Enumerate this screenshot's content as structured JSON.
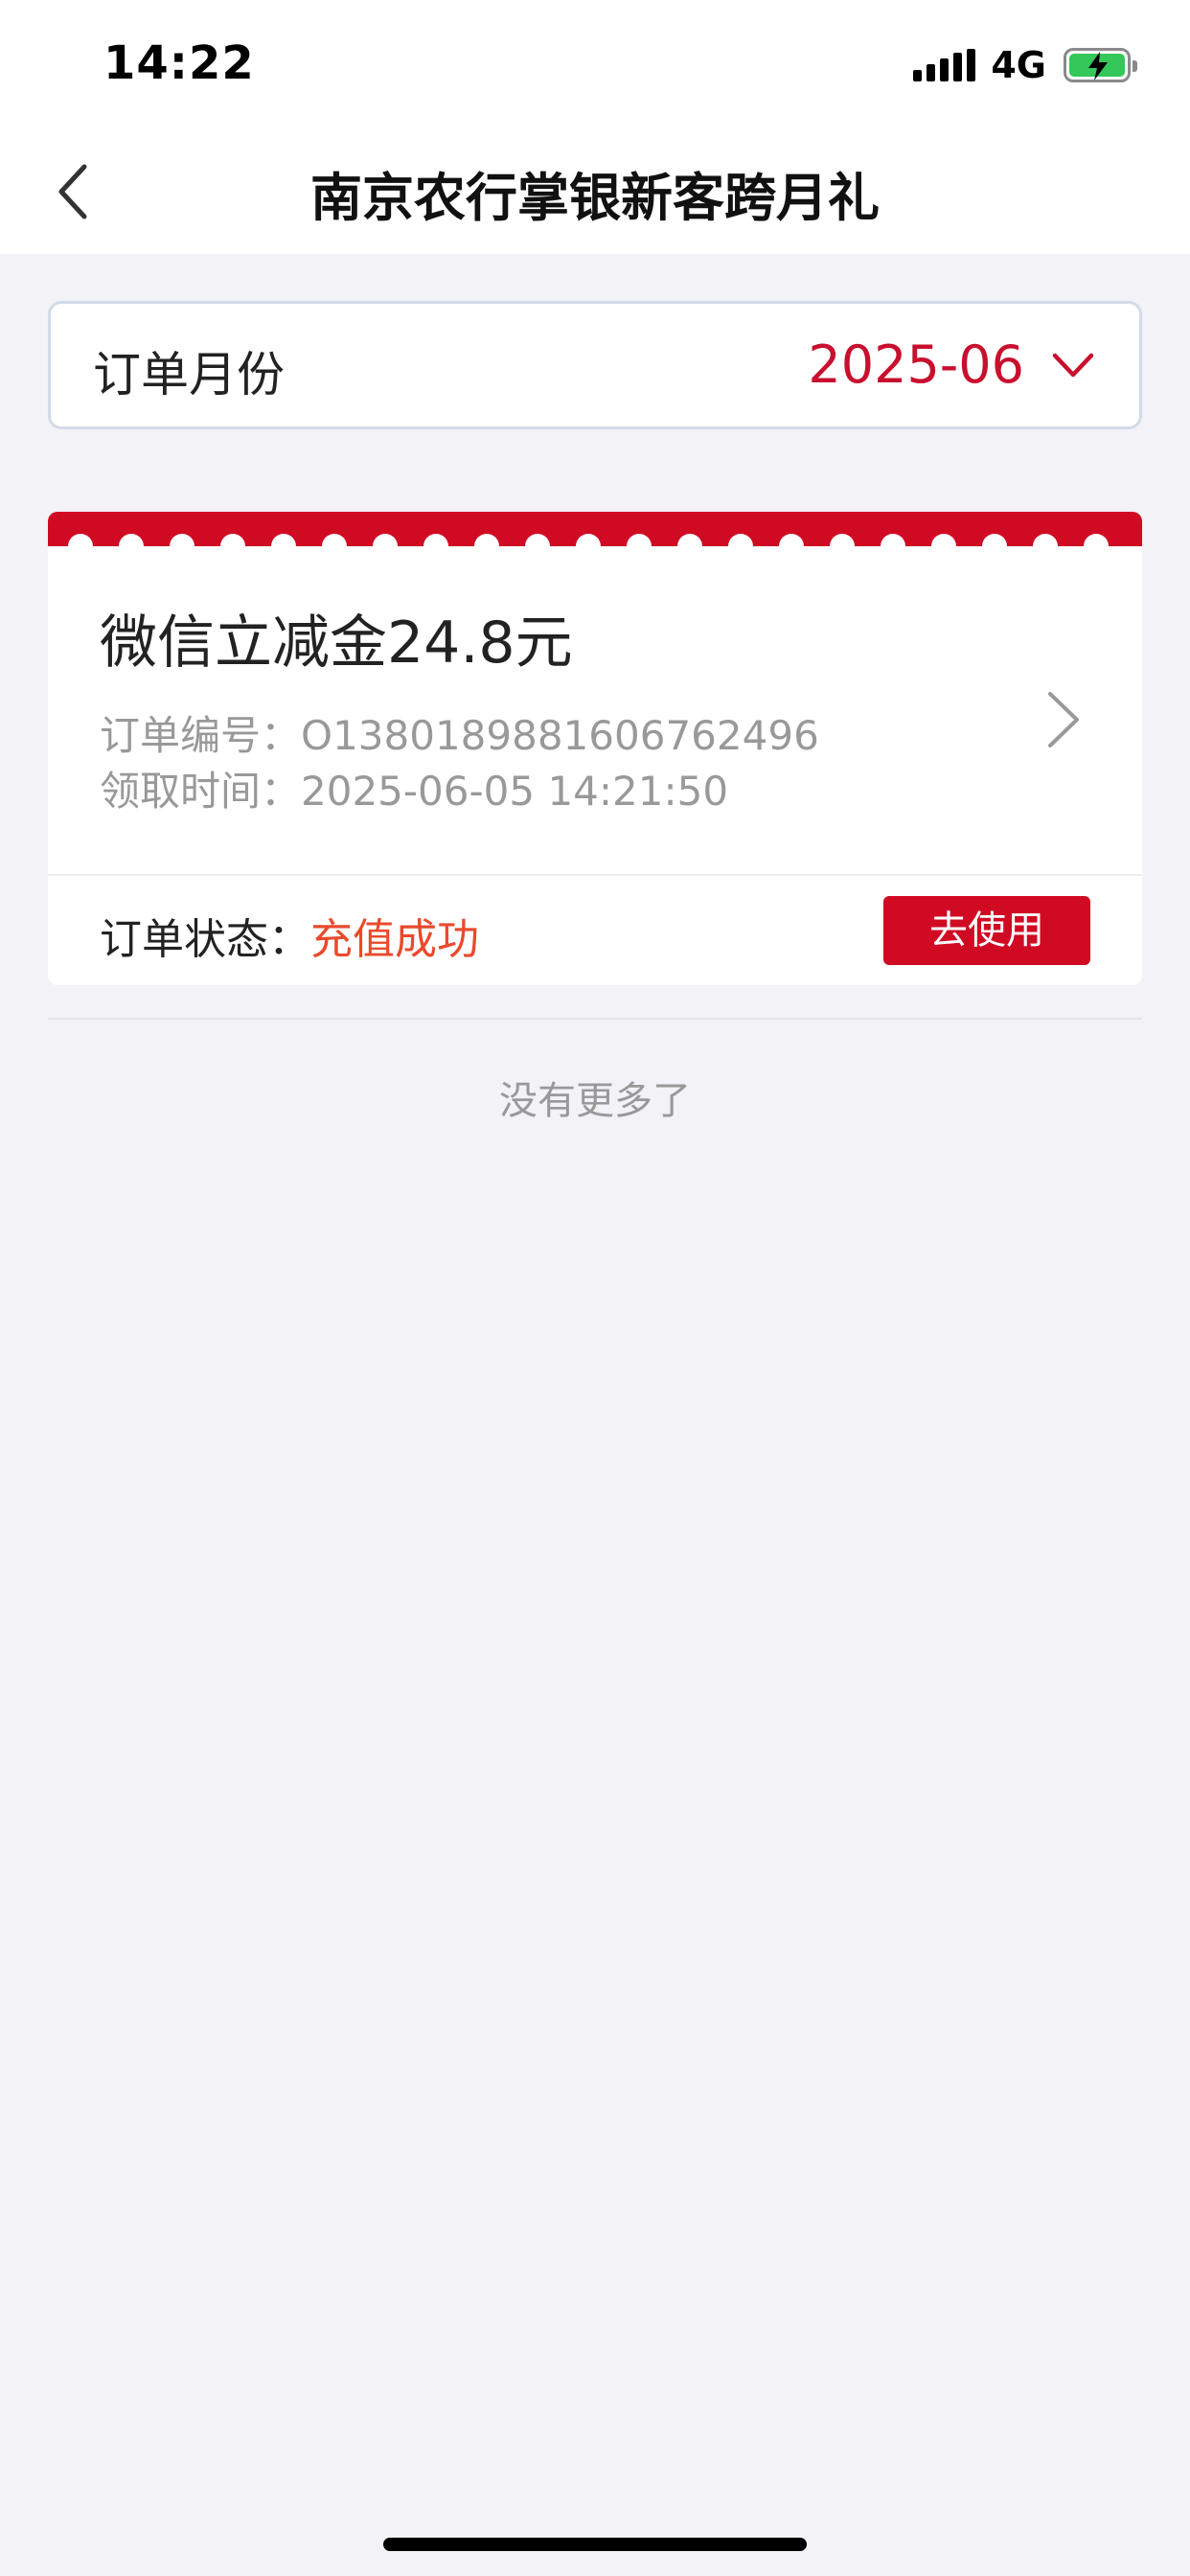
{
  "status_bar": {
    "time": "14:22",
    "network": "4G",
    "battery_level": 1.0,
    "charging": true
  },
  "header": {
    "title": "南京农行掌银新客跨月礼"
  },
  "month_selector": {
    "label": "订单月份",
    "value": "2025-06"
  },
  "order": {
    "title": "微信立减金24.8元",
    "order_no_label": "订单编号：",
    "order_no": "O1380189881606762496",
    "claim_time_label": "领取时间：",
    "claim_time": "2025-06-05 14:21:50",
    "status_label": "订单状态：",
    "status_value": "充值成功",
    "use_button": "去使用"
  },
  "list_footer": "没有更多了",
  "colors": {
    "brand_red": "#d10a24",
    "month_red": "#c8102e",
    "status_orange": "#e84a2c",
    "background": "#f2f2f7"
  }
}
